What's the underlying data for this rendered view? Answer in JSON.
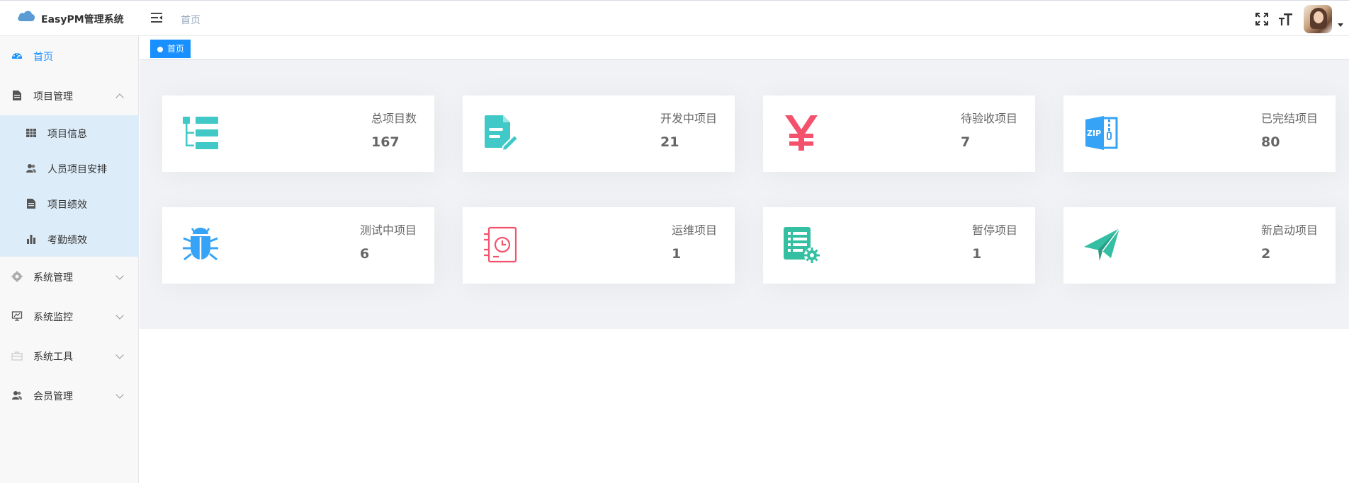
{
  "app": {
    "title": "EasyPM管理系统"
  },
  "header": {
    "breadcrumb": "首页"
  },
  "sidebar": {
    "items": [
      {
        "label": "首页",
        "icon": "dashboard-icon",
        "active": true
      },
      {
        "label": "项目管理",
        "icon": "document-icon",
        "expanded": true,
        "children": [
          {
            "label": "项目信息",
            "icon": "table-icon"
          },
          {
            "label": "人员项目安排",
            "icon": "peoples-icon"
          },
          {
            "label": "项目绩效",
            "icon": "document-icon"
          },
          {
            "label": "考勤绩效",
            "icon": "bar-chart-icon"
          }
        ]
      },
      {
        "label": "系统管理",
        "icon": "gear-icon"
      },
      {
        "label": "系统监控",
        "icon": "monitor-icon"
      },
      {
        "label": "系统工具",
        "icon": "toolbox-icon"
      },
      {
        "label": "会员管理",
        "icon": "peoples-icon"
      }
    ]
  },
  "tags": [
    {
      "label": "首页",
      "active": true
    }
  ],
  "stats": [
    {
      "label": "总项目数",
      "value": "167",
      "icon": "tree-list-icon",
      "color": "#40c9c6"
    },
    {
      "label": "开发中项目",
      "value": "21",
      "icon": "edit-document-icon",
      "color": "#40c9c6"
    },
    {
      "label": "待验收项目",
      "value": "7",
      "icon": "yen-icon",
      "color": "#f4516c"
    },
    {
      "label": "已完结项目",
      "value": "80",
      "icon": "zip-file-icon",
      "color": "#36a3f7"
    },
    {
      "label": "测试中项目",
      "value": "6",
      "icon": "bug-icon",
      "color": "#36a3f7"
    },
    {
      "label": "运维项目",
      "value": "1",
      "icon": "clock-document-icon",
      "color": "#f4516c"
    },
    {
      "label": "暂停项目",
      "value": "1",
      "icon": "settings-document-icon",
      "color": "#34bfa3"
    },
    {
      "label": "新启动项目",
      "value": "2",
      "icon": "paper-plane-icon",
      "color": "#34bfa3"
    }
  ],
  "colors": {
    "accent": "#1890ff",
    "submenu_bg": "#dcecf8",
    "panel_bg": "#f0f2f5"
  }
}
